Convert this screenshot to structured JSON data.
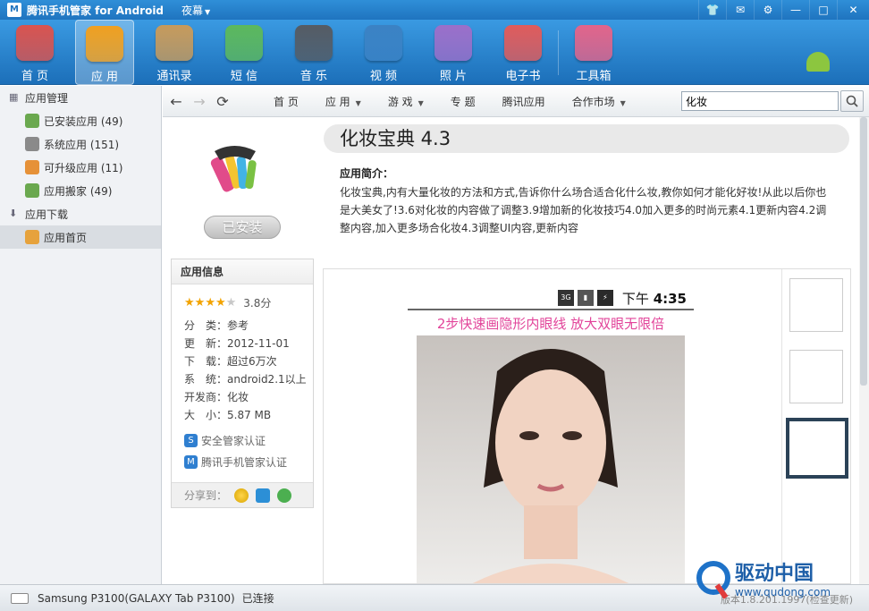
{
  "titlebar": {
    "title": "腾讯手机管家 for Android",
    "skin": "夜幕"
  },
  "toolbar": {
    "items": [
      {
        "label": "首 页",
        "icon": "store-icon",
        "color": "#d9534f"
      },
      {
        "label": "应 用",
        "icon": "blocks-icon",
        "color": "#f0a020"
      },
      {
        "label": "通讯录",
        "icon": "contacts-icon",
        "color": "#c79a5b"
      },
      {
        "label": "短 信",
        "icon": "sms-icon",
        "color": "#5cb85c"
      },
      {
        "label": "音 乐",
        "icon": "music-icon",
        "color": "#555b63"
      },
      {
        "label": "视 频",
        "icon": "video-icon",
        "color": "#3b82c4"
      },
      {
        "label": "照 片",
        "icon": "photo-icon",
        "color": "#9b6fc9"
      },
      {
        "label": "电子书",
        "icon": "ebook-icon",
        "color": "#e05b5b"
      },
      {
        "label": "工具箱",
        "icon": "toolbox-icon",
        "color": "#e2648a"
      }
    ],
    "active_index": 1
  },
  "sidebar": {
    "app_manage": {
      "title": "应用管理",
      "items": [
        {
          "label": "已安装应用 (49)",
          "color": "#6aa84f"
        },
        {
          "label": "系统应用 (151)",
          "color": "#8a8a8a"
        },
        {
          "label": "可升级应用 (11)",
          "color": "#e69138"
        },
        {
          "label": "应用搬家 (49)",
          "color": "#6aa84f"
        }
      ]
    },
    "download": {
      "title": "应用下载",
      "items": [
        {
          "label": "应用首页",
          "color": "#e6a23c"
        }
      ]
    }
  },
  "navbar": {
    "links": [
      {
        "label": "首 页",
        "dropdown": false
      },
      {
        "label": "应 用",
        "dropdown": true
      },
      {
        "label": "游 戏",
        "dropdown": true
      },
      {
        "label": "专 题",
        "dropdown": false
      },
      {
        "label": "腾讯应用",
        "dropdown": false
      },
      {
        "label": "合作市场",
        "dropdown": true
      }
    ],
    "search_value": "化妆"
  },
  "app": {
    "name": "化妆宝典 4.3",
    "install_label": "已安装",
    "intro_heading": "应用简介：",
    "intro_text": "化妆宝典,内有大量化妆的方法和方式,告诉你什么场合适合化什么妆,教你如何才能化好妆!从此以后你也是大美女了!3.6对化妆的内容做了调整3.9增加新的化妆技巧4.0加入更多的时尚元素4.1更新内容4.2调整内容,加入更多场合化妆4.3调整UI内容,更新内容",
    "info": {
      "heading": "应用信息",
      "rating": 3.8,
      "rating_label": "3.8分",
      "rows": [
        {
          "label": "分　类：",
          "value": "参考"
        },
        {
          "label": "更　新：",
          "value": "2012-11-01"
        },
        {
          "label": "下　载：",
          "value": "超过6万次"
        },
        {
          "label": "系　统：",
          "value": "android2.1以上"
        },
        {
          "label": "开发商：",
          "value": "化妆"
        },
        {
          "label": "大　小：",
          "value": "5.87 MB"
        }
      ],
      "certs": [
        {
          "label": "安全管家认证",
          "icon": "shield-s-icon",
          "color": "#2f7fd0"
        },
        {
          "label": "腾讯手机管家认证",
          "icon": "shield-m-icon",
          "color": "#2f7fd0"
        }
      ],
      "share_label": "分享到："
    },
    "screenshot": {
      "status_time_prefix": "下午",
      "status_time": "4:35",
      "status_3g": "3G",
      "caption": "2步快速画隐形内眼线 放大双眼无限倍"
    }
  },
  "statusbar": {
    "device": "Samsung P3100(GALAXY Tab P3100)",
    "state": "已连接",
    "version": "版本1.8.201.1997(检查更新)"
  },
  "watermark": {
    "brand": "驱动中国",
    "url": "www.qudong.com"
  }
}
